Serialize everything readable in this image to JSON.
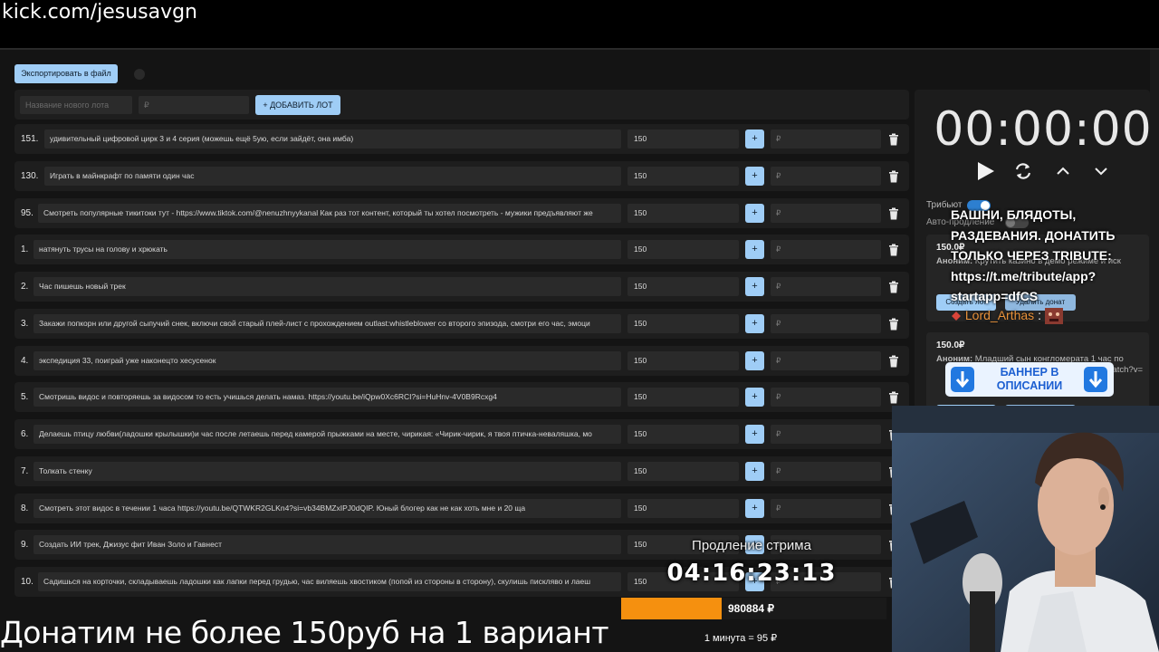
{
  "url": "kick.com/jesusavgn",
  "toolbar": {
    "export_label": "Экспортировать в файл"
  },
  "new_lot": {
    "name_placeholder": "Название нового лота",
    "price_placeholder": "₽",
    "add_label": "+ ДОБАВИТЬ ЛОТ"
  },
  "lots": [
    {
      "num": "151.",
      "text": "удивительный цифровой цирк 3 и 4 серия (можешь ещё 5ую, если зайдёт, она имба)",
      "amount": "150",
      "plus": "+",
      "rub": "₽"
    },
    {
      "num": "130.",
      "text": "Играть в майнкрафт по памяти один час",
      "amount": "150",
      "plus": "+",
      "rub": "₽"
    },
    {
      "num": "95.",
      "text": "Смотреть популярные тикитоки тут - https://www.tiktok.com/@nenuzhnyykanal Как раз тот контент, который ты хотел посмотреть - мужики предъявляют же",
      "amount": "150",
      "plus": "+",
      "rub": "₽"
    },
    {
      "num": "1.",
      "text": "натянуть трусы на голову и хрюкать",
      "amount": "150",
      "plus": "+",
      "rub": "₽"
    },
    {
      "num": "2.",
      "text": "Час пишешь новый трек",
      "amount": "150",
      "plus": "+",
      "rub": "₽"
    },
    {
      "num": "3.",
      "text": "Закажи попкорн или другой сыпучий снек, включи свой старый плей-лист с прохождением outlast:whistleblower со второго эпизода, смотри его час, эмоци",
      "amount": "150",
      "plus": "+",
      "rub": "₽"
    },
    {
      "num": "4.",
      "text": "экспедиция 33, поиграй уже наконецто хесусенок",
      "amount": "150",
      "plus": "+",
      "rub": "₽"
    },
    {
      "num": "5.",
      "text": "Смотришь видос и повторяешь за видосом то есть учишься делать намаз. https://youtu.be/iQpw0Xc6RCI?si=HuHnv-4V0B9Rcxg4",
      "amount": "150",
      "plus": "+",
      "rub": "₽"
    },
    {
      "num": "6.",
      "text": "Делаешь птицу любви(ладошки крылышки)и час после летаешь перед камерой прыжками на месте, чирикая: «Чирик-чирик, я твоя птичка-неваляшка, мо",
      "amount": "150",
      "plus": "+",
      "rub": "₽"
    },
    {
      "num": "7.",
      "text": "Толкать стенку",
      "amount": "150",
      "plus": "+",
      "rub": "₽"
    },
    {
      "num": "8.",
      "text": "Смотреть этот видос в течении 1 часа https://youtu.be/QTWKR2GLKn4?si=vb34BMZxIPJ0dQIP. Юный блогер как не как хоть мне и 20 ща",
      "amount": "150",
      "plus": "+",
      "rub": "₽"
    },
    {
      "num": "9.",
      "text": "Создать ИИ трек, Джизус фит Иван Золо и Гавнест",
      "amount": "150",
      "plus": "+",
      "rub": "₽"
    },
    {
      "num": "10.",
      "text": "Садишься на корточки, складываешь ладошки как лапки перед грудью, час виляешь хвостиком (попой из стороны в сторону), скулишь пискляво и лаеш",
      "amount": "150",
      "plus": "+",
      "rub": "₽"
    }
  ],
  "panel": {
    "timer": "00:00:00",
    "tribute_label": "Трибьют",
    "auto_label": "Авто-продление"
  },
  "donations": [
    {
      "price": "150.0₽",
      "text_bold": "Аноним:",
      "text": " Крутить казино в демо режиме и иск",
      "create_label": "Создать лот",
      "delete_label": "Удалить донат"
    },
    {
      "price": "150.0₽",
      "text_bold": "Аноним:",
      "text": " Младший сын конгломерата 1 час по",
      "tail": "/watch?v=",
      "create_label": "",
      "delete_label": ""
    }
  ],
  "overlay": {
    "message": "БАШНИ, БЛЯДОТЫ, РАЗДЕВАНИЯ. ДОНАТИТЬ ТОЛЬКО ЧЕРЕЗ TRIBUTE: https://t.me/tribute/app?startapp=dfCS",
    "chat_user": "Lord_Arthas",
    "chat_colon": ":",
    "banner_text": "БАННЕР В ОПИСАНИИ"
  },
  "extension": {
    "label": "Продление стрима",
    "timer": "04:16:23:13",
    "total": "980884 ₽",
    "progress": 0.38,
    "rate": "1 минута = 95 ₽"
  },
  "caption": "Донатим не более 150руб на 1 вариант",
  "colors": {
    "accent": "#9fcdf6",
    "progress": "#f5900f",
    "bg": "#141414",
    "row": "#1e1e1e"
  }
}
